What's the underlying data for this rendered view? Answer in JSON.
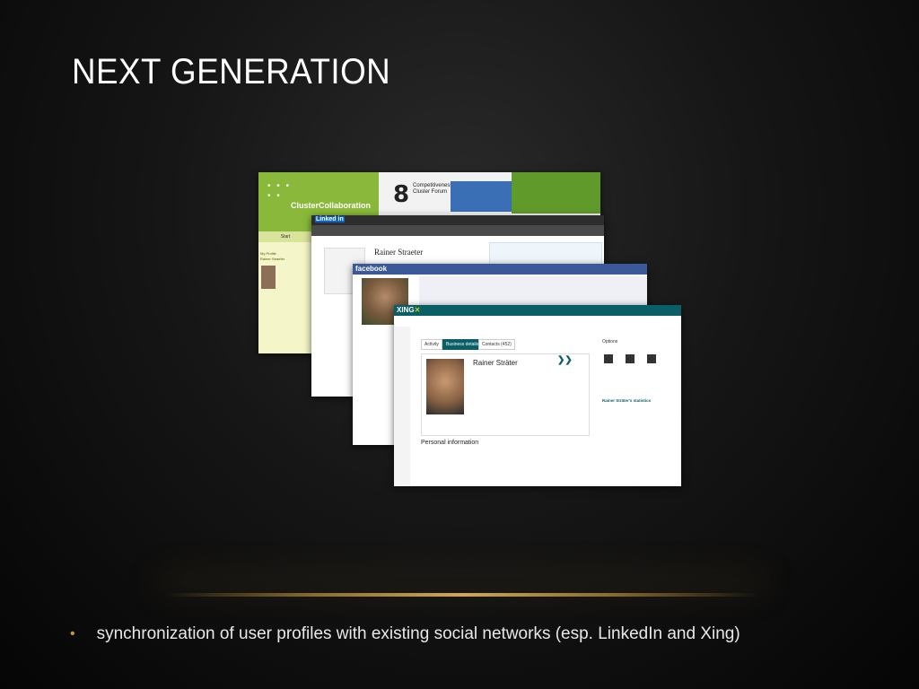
{
  "slide": {
    "title": "NEXT GENERATION",
    "bullets": [
      "synchronization of user profiles with existing social networks (esp. LinkedIn and Xing)"
    ]
  },
  "collage": {
    "cluster": {
      "brand": "ClusterCollaboration",
      "forum_number": "8",
      "forum_text": "Competitiveness Cluster Forum",
      "nav_start": "Start",
      "sidebar_heading": "My Profile",
      "sidebar_name": "Rainer Straeter"
    },
    "linkedin": {
      "logo": "Linked in",
      "profile_name": "Rainer Straeter"
    },
    "facebook": {
      "logo": "facebook"
    },
    "xing": {
      "logo": "XING",
      "tabs": [
        "Activity",
        "Business details",
        "Contacts (452)"
      ],
      "profile_name": "Rainer Sträter",
      "section_title": "Personal information",
      "options_label": "Options",
      "stats_label": "Rainer Sträter's statistics"
    }
  }
}
